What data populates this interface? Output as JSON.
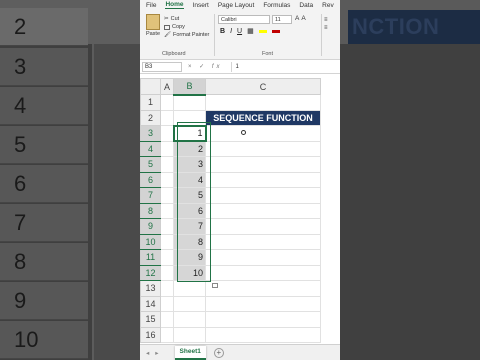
{
  "menu": [
    "File",
    "Home",
    "Insert",
    "Page Layout",
    "Formulas",
    "Data",
    "Rev"
  ],
  "active_menu": "Home",
  "clipboard": {
    "paste": "Paste",
    "cut": "Cut",
    "copy": "Copy",
    "format_painter": "Format Painter",
    "group": "Clipboard"
  },
  "font": {
    "name": "Calibri",
    "size": "11",
    "group": "Font",
    "bold": "B",
    "italic": "I",
    "underline": "U",
    "grow": "A",
    "shrink": "A"
  },
  "formula_bar": {
    "name_box": "B3",
    "fx": "fx",
    "value": "1"
  },
  "columns": [
    "A",
    "B",
    "C"
  ],
  "rows": [
    "1",
    "2",
    "3",
    "4",
    "5",
    "6",
    "7",
    "8",
    "9",
    "10",
    "11",
    "12",
    "13",
    "14",
    "15",
    "16"
  ],
  "title_cell": "SEQUENCE FUNCTION",
  "sequence": [
    "1",
    "2",
    "3",
    "4",
    "5",
    "6",
    "7",
    "8",
    "9",
    "10"
  ],
  "sheet_tab": "Sheet1",
  "bg_left": {
    "rows": [
      "2",
      "3",
      "4",
      "5",
      "6",
      "7",
      "8",
      "9",
      "10"
    ]
  },
  "bg_right": {
    "text": "NCTION"
  },
  "colors": {
    "accent": "#217346",
    "title_fill": "#1f3864"
  }
}
